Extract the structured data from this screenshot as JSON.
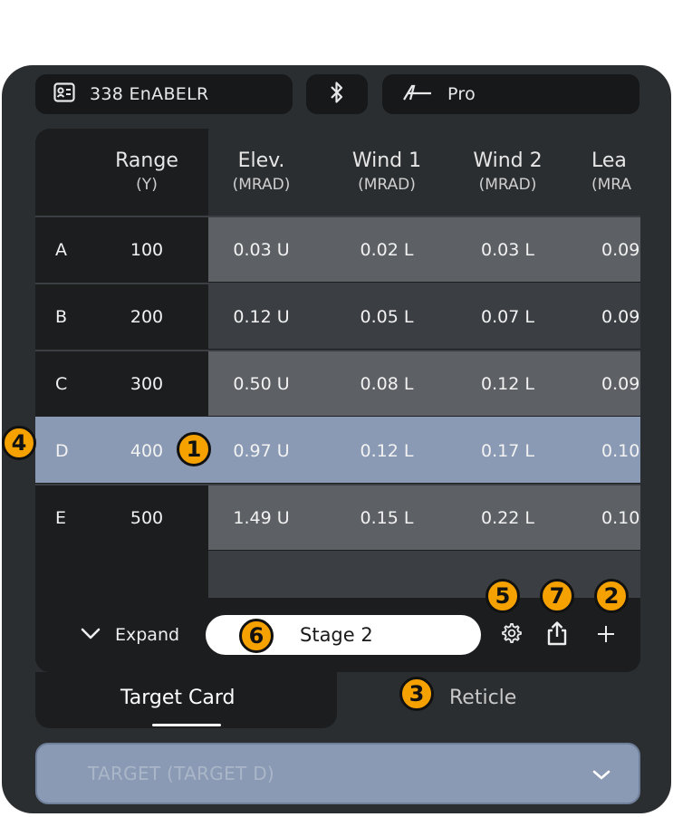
{
  "topbar": {
    "profile_name": "338 EnABELR",
    "device_label": "Pro"
  },
  "table": {
    "headers": [
      {
        "title": "Range",
        "unit": "(Y)"
      },
      {
        "title": "Elev.",
        "unit": "(MRAD)"
      },
      {
        "title": "Wind 1",
        "unit": "(MRAD)"
      },
      {
        "title": "Wind 2",
        "unit": "(MRAD)"
      },
      {
        "title": "Lea",
        "unit": "(MRA"
      }
    ],
    "rows": [
      {
        "letter": "A",
        "range": "100",
        "elev": "0.03 U",
        "wind1": "0.02 L",
        "wind2": "0.03 L",
        "lead": "0.09"
      },
      {
        "letter": "B",
        "range": "200",
        "elev": "0.12 U",
        "wind1": "0.05 L",
        "wind2": "0.07 L",
        "lead": "0.09"
      },
      {
        "letter": "C",
        "range": "300",
        "elev": "0.50 U",
        "wind1": "0.08 L",
        "wind2": "0.12 L",
        "lead": "0.09"
      },
      {
        "letter": "D",
        "range": "400",
        "elev": "0.97 U",
        "wind1": "0.12 L",
        "wind2": "0.17 L",
        "lead": "0.10"
      },
      {
        "letter": "E",
        "range": "500",
        "elev": "1.49 U",
        "wind1": "0.15 L",
        "wind2": "0.22 L",
        "lead": "0.10"
      }
    ],
    "selected_row": "D"
  },
  "controls": {
    "expand_label": "Expand",
    "stage_label": "Stage 2"
  },
  "tabs": {
    "target_card": "Target Card",
    "reticle": "Reticle"
  },
  "target_select": {
    "value": "TARGET (TARGET D)"
  },
  "callouts": [
    "1",
    "2",
    "3",
    "4",
    "5",
    "6",
    "7"
  ],
  "colors": {
    "callout": "#f5a100",
    "selected_row": "#8a9ab4",
    "device_bg": "#2b2e31"
  }
}
